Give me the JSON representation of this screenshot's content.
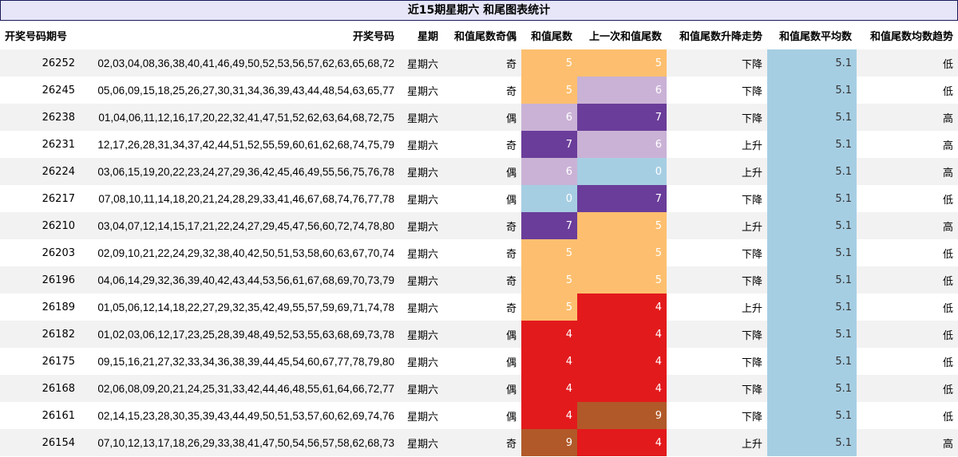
{
  "title": "近15期星期六 和尾图表统计",
  "colors": {
    "5": "#fdbf6f",
    "6": "#cab2d6",
    "7": "#6a3d9a",
    "0": "#a6cee3",
    "4": "#e31a1c",
    "9": "#b15928",
    "avg_bg": "#a6cee3",
    "title_bg": "#e6e6f8"
  },
  "headers": [
    "开奖号码期号",
    "开奖号码",
    "星期",
    "和值尾数奇偶",
    "和值尾数",
    "上一次和值尾数",
    "和值尾数升降走势",
    "和值尾数平均数",
    "和值尾数均数趋势"
  ],
  "rows": [
    {
      "period": "26252",
      "numbers": "02,03,04,08,36,38,40,41,46,49,50,52,53,56,57,62,63,65,68,72",
      "weekday": "星期六",
      "parity": "奇",
      "tail": "5",
      "prev": "5",
      "trend": "下降",
      "avg": "5.1",
      "avg_trend": "低"
    },
    {
      "period": "26245",
      "numbers": "05,06,09,15,18,25,26,27,30,31,34,36,39,43,44,48,54,63,65,77",
      "weekday": "星期六",
      "parity": "奇",
      "tail": "5",
      "prev": "6",
      "trend": "下降",
      "avg": "5.1",
      "avg_trend": "低"
    },
    {
      "period": "26238",
      "numbers": "01,04,06,11,12,16,17,20,22,32,41,47,51,52,62,63,64,68,72,75",
      "weekday": "星期六",
      "parity": "偶",
      "tail": "6",
      "prev": "7",
      "trend": "下降",
      "avg": "5.1",
      "avg_trend": "高"
    },
    {
      "period": "26231",
      "numbers": "12,17,26,28,31,34,37,42,44,51,52,55,59,60,61,62,68,74,75,79",
      "weekday": "星期六",
      "parity": "奇",
      "tail": "7",
      "prev": "6",
      "trend": "上升",
      "avg": "5.1",
      "avg_trend": "高"
    },
    {
      "period": "26224",
      "numbers": "03,06,15,19,20,22,23,24,27,29,36,42,45,46,49,55,56,75,76,78",
      "weekday": "星期六",
      "parity": "偶",
      "tail": "6",
      "prev": "0",
      "trend": "上升",
      "avg": "5.1",
      "avg_trend": "高"
    },
    {
      "period": "26217",
      "numbers": "07,08,10,11,14,18,20,21,24,28,29,33,41,46,67,68,74,76,77,78",
      "weekday": "星期六",
      "parity": "偶",
      "tail": "0",
      "prev": "7",
      "trend": "下降",
      "avg": "5.1",
      "avg_trend": "低"
    },
    {
      "period": "26210",
      "numbers": "03,04,07,12,14,15,17,21,22,24,27,29,45,47,56,60,72,74,78,80",
      "weekday": "星期六",
      "parity": "奇",
      "tail": "7",
      "prev": "5",
      "trend": "上升",
      "avg": "5.1",
      "avg_trend": "高"
    },
    {
      "period": "26203",
      "numbers": "02,09,10,21,22,24,29,32,38,40,42,50,51,53,58,60,63,67,70,74",
      "weekday": "星期六",
      "parity": "奇",
      "tail": "5",
      "prev": "5",
      "trend": "下降",
      "avg": "5.1",
      "avg_trend": "低"
    },
    {
      "period": "26196",
      "numbers": "04,06,14,29,32,36,39,40,42,43,44,53,56,61,67,68,69,70,73,79",
      "weekday": "星期六",
      "parity": "奇",
      "tail": "5",
      "prev": "5",
      "trend": "下降",
      "avg": "5.1",
      "avg_trend": "低"
    },
    {
      "period": "26189",
      "numbers": "01,05,06,12,14,18,22,27,29,32,35,42,49,55,57,59,69,71,74,78",
      "weekday": "星期六",
      "parity": "奇",
      "tail": "5",
      "prev": "4",
      "trend": "上升",
      "avg": "5.1",
      "avg_trend": "低"
    },
    {
      "period": "26182",
      "numbers": "01,02,03,06,12,17,23,25,28,39,48,49,52,53,55,63,68,69,73,78",
      "weekday": "星期六",
      "parity": "偶",
      "tail": "4",
      "prev": "4",
      "trend": "下降",
      "avg": "5.1",
      "avg_trend": "低"
    },
    {
      "period": "26175",
      "numbers": "09,15,16,21,27,32,33,34,36,38,39,44,45,54,60,67,77,78,79,80",
      "weekday": "星期六",
      "parity": "偶",
      "tail": "4",
      "prev": "4",
      "trend": "下降",
      "avg": "5.1",
      "avg_trend": "低"
    },
    {
      "period": "26168",
      "numbers": "02,06,08,09,20,21,24,25,31,33,42,44,46,48,55,61,64,66,72,77",
      "weekday": "星期六",
      "parity": "偶",
      "tail": "4",
      "prev": "4",
      "trend": "下降",
      "avg": "5.1",
      "avg_trend": "低"
    },
    {
      "period": "26161",
      "numbers": "02,14,15,23,28,30,35,39,43,44,49,50,51,53,57,60,62,69,74,76",
      "weekday": "星期六",
      "parity": "偶",
      "tail": "4",
      "prev": "9",
      "trend": "下降",
      "avg": "5.1",
      "avg_trend": "低"
    },
    {
      "period": "26154",
      "numbers": "07,10,12,13,17,18,26,29,33,38,41,47,50,54,56,57,58,62,68,73",
      "weekday": "星期六",
      "parity": "奇",
      "tail": "9",
      "prev": "4",
      "trend": "上升",
      "avg": "5.1",
      "avg_trend": "高"
    }
  ]
}
